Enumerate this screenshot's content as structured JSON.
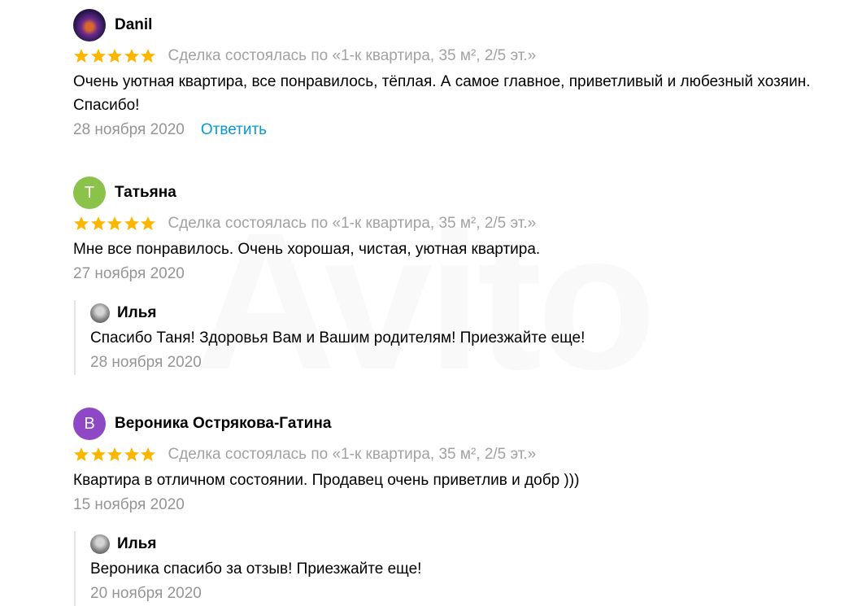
{
  "colors": {
    "star": "#fbb700",
    "link": "#0a97d6",
    "muted": "#959595",
    "avatar_t": "#8bc34a",
    "avatar_v": "#8e48c6"
  },
  "reviews": [
    {
      "author": "Danil",
      "avatar": {
        "type": "image",
        "icon": "profile-photo-icon"
      },
      "rating": 5,
      "deal": "Сделка состоялась по «1-к квартира, 35 м², 2/5 эт.»",
      "text": "Очень уютная квартира, все понравилось, тёплая. А самое главное, приветливый и любезный хозяин. Спасибо!",
      "date": "28 ноября 2020",
      "reply_label": "Ответить"
    },
    {
      "author": "Татьяна",
      "avatar": {
        "type": "letter",
        "letter": "Т"
      },
      "rating": 5,
      "deal": "Сделка состоялась по «1-к квартира, 35 м², 2/5 эт.»",
      "text": "Мне все понравилось. Очень хорошая, чистая, уютная квартира.",
      "date": "27 ноября 2020",
      "answer": {
        "author": "Илья",
        "text": "Спасибо Таня! Здоровья Вам и Вашим родителям! Приезжайте еще!",
        "date": "28 ноября 2020"
      }
    },
    {
      "author": "Вероника Острякова-Гатина",
      "avatar": {
        "type": "letter",
        "letter": "В"
      },
      "rating": 5,
      "deal": "Сделка состоялась по «1-к квартира, 35 м², 2/5 эт.»",
      "text": "Квартира в отличном состоянии. Продавец очень приветлив и добр )))",
      "date": "15 ноября 2020",
      "answer": {
        "author": "Илья",
        "text": "Вероника спасибо за отзыв! Приезжайте еще!",
        "date": "20 ноября 2020"
      }
    }
  ],
  "watermark": "Avito"
}
